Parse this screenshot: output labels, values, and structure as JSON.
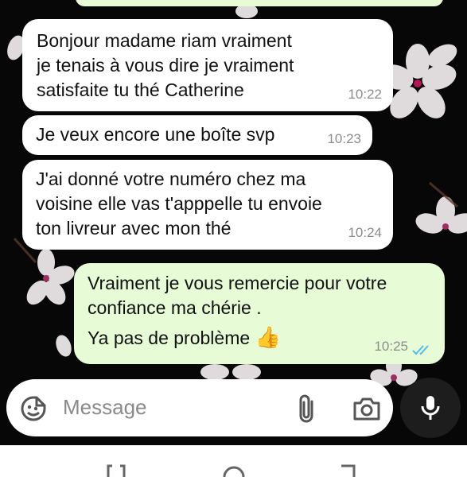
{
  "messages": [
    {
      "direction": "incoming",
      "text": "Bonjour madame riam  vraiment\nje tenais à vous dire je vraiment\nsatisfaite tu thé Catherine",
      "time": "10:22"
    },
    {
      "direction": "incoming",
      "text": "Je veux encore une boîte svp",
      "time": "10:23"
    },
    {
      "direction": "incoming",
      "text": "J'ai donné votre numéro chez ma\nvoisine elle vas t'apppelle tu envoie\nton livreur avec mon thé",
      "time": "10:24"
    },
    {
      "direction": "outgoing",
      "text": "Vraiment je vous remercie pour votre\nconfiance ma chérie .",
      "text2": "Ya pas de problème",
      "emoji": "👍",
      "time": "10:25",
      "status": "read"
    }
  ],
  "composer": {
    "placeholder": "Message",
    "icons": [
      "emoji-icon",
      "attach-icon",
      "camera-icon",
      "mic-icon"
    ]
  },
  "colors": {
    "background": "#070707",
    "incoming_bubble": "#ffffff",
    "outgoing_bubble": "#e6fbd6",
    "read_ticks": "#53bdeb"
  }
}
